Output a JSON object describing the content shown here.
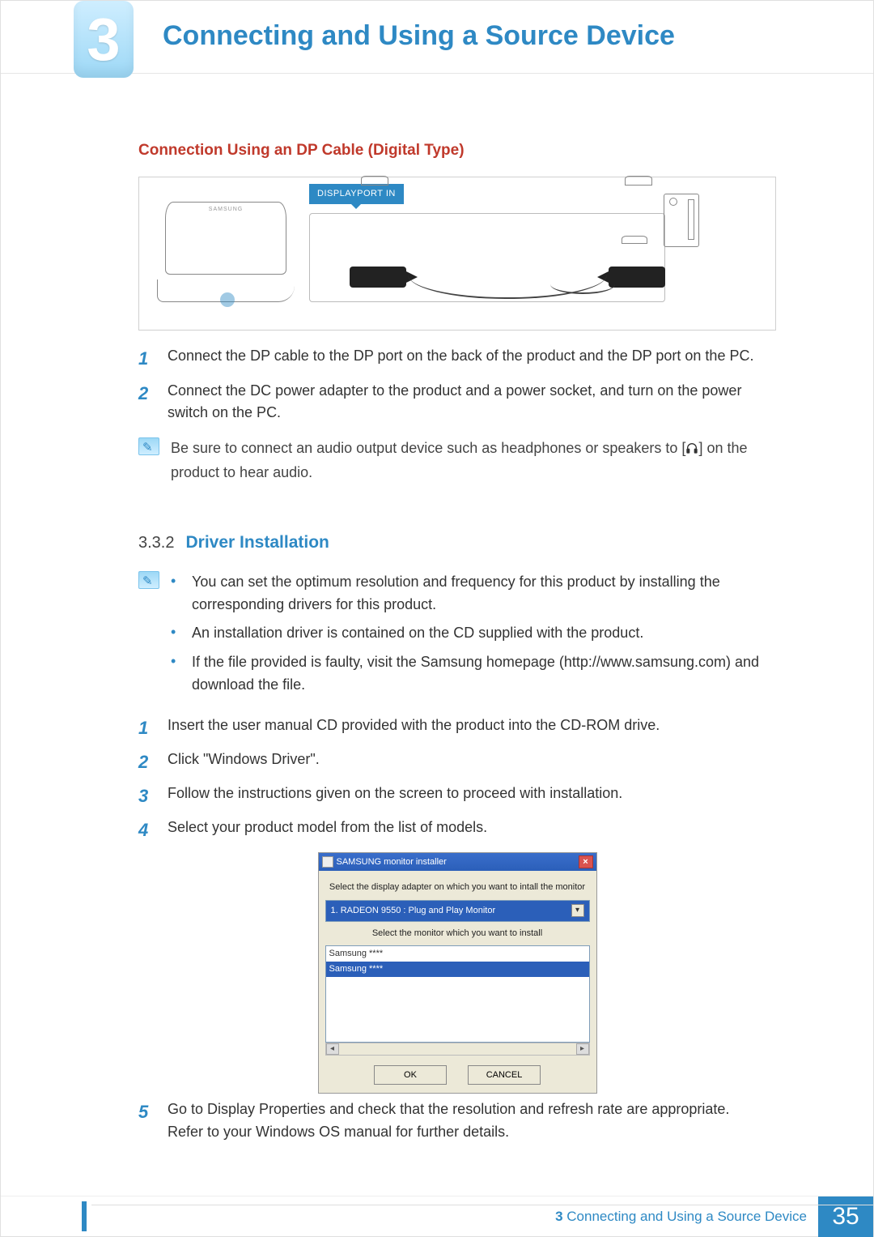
{
  "header": {
    "chapter_number": "3",
    "chapter_title": "Connecting and Using a Source Device"
  },
  "section1": {
    "subheading": "Connection Using an DP Cable (Digital Type)",
    "diagram": {
      "port_label": "DISPLAYPORT IN",
      "monitor_brand": "SAMSUNG"
    },
    "steps": [
      "Connect the DP cable to the DP port on the back of the product and the DP port on the PC.",
      "Connect the DC power adapter to the product and a power socket, and turn on the power switch on the PC."
    ],
    "note_pre": "Be sure to connect an audio output device such as headphones or speakers to [",
    "note_post": "] on the product to hear audio."
  },
  "section2": {
    "number": "3.3.2",
    "title": "Driver Installation",
    "note_bullets": [
      "You can set the optimum resolution and frequency for this product by installing the corresponding drivers for this product.",
      "An installation driver is contained on the CD supplied with the product.",
      "If the file provided is faulty, visit the Samsung homepage (http://www.samsung.com) and download the file."
    ],
    "steps_a": [
      "Insert the user manual CD provided with the product into the CD-ROM drive.",
      "Click \"Windows Driver\".",
      "Follow the instructions given on the screen to proceed with installation.",
      "Select your product model from the list of models."
    ],
    "dialog": {
      "title": "SAMSUNG monitor installer",
      "label_adapter": "Select the display adapter on which you want to intall the monitor",
      "select_value": "1. RADEON 9550 : Plug and Play Monitor",
      "label_monitor": "Select the monitor which you want to install",
      "list_items": [
        "Samsung ****",
        "Samsung ****"
      ],
      "btn_ok": "OK",
      "btn_cancel": "CANCEL"
    },
    "steps_b_num": "5",
    "steps_b_line1": "Go to Display Properties and check that the resolution and refresh rate are appropriate.",
    "steps_b_line2": "Refer to your Windows OS manual for further details."
  },
  "footer": {
    "chapter_number": "3",
    "chapter_title": "Connecting and Using a Source Device",
    "page_number": "35"
  }
}
